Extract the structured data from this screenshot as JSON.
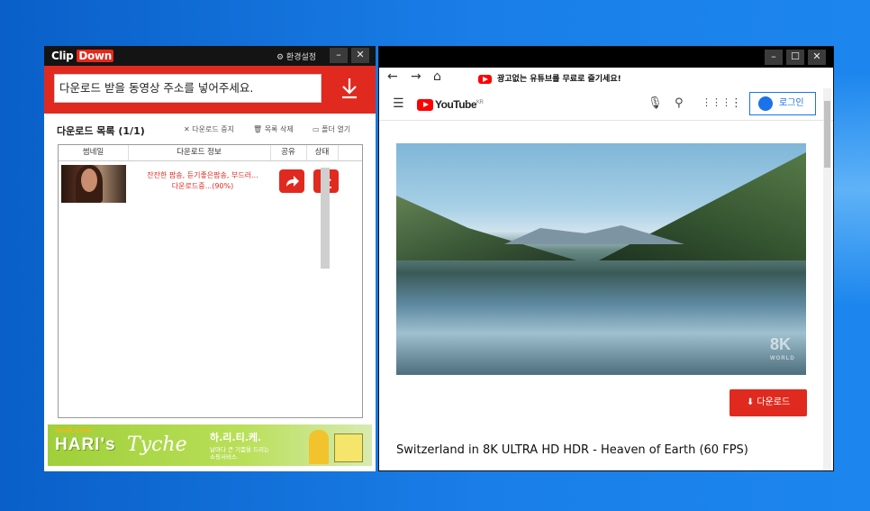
{
  "clipdown": {
    "logo": {
      "clip": "Clip",
      "down": "Down"
    },
    "settings_label": "⚙ 환경설정",
    "window_buttons": {
      "min": "–",
      "close": "✕"
    },
    "url_placeholder": "다운로드 받을 동영상 주소를 넣어주세요.",
    "list_title": "다운로드 목록 (1/1)",
    "actions": {
      "stop": "✕ 다운로드 중지",
      "delete": "🗑 목록 삭제",
      "folder": "▭ 폴더 열기"
    },
    "columns": [
      "썸네일",
      "다운로드 정보",
      "공유",
      "상태"
    ],
    "row": {
      "info_line1": "잔잔한 팝송, 듣기좋은팝송, 부드러...",
      "info_line2": "다운로드중...(90%)",
      "progress_percent": 90
    },
    "banner": {
      "mall": "mall.com",
      "haris": "HARI's",
      "tyche": "Tyche",
      "tagline": "하.리.티.케.",
      "sub1": "날마다 큰 기쁨을 드리는",
      "sub2": "쇼핑서비스."
    }
  },
  "browser": {
    "window_buttons": {
      "min": "–",
      "max": "☐",
      "close": "✕"
    },
    "nav": {
      "back": "←",
      "forward": "→",
      "home": "⌂"
    },
    "promo_text": "광고없는 유튜브를 무료로 즐기세요!",
    "youtube": {
      "logo": "YouTube",
      "region": "KR",
      "login": "로그인"
    },
    "badge": {
      "big": "8K",
      "small": "WORLD"
    },
    "download_button": "다운로드",
    "video_title": "Switzerland in 8K ULTRA HD HDR - Heaven of Earth (60 FPS)"
  },
  "colors": {
    "accent_red": "#e02a1f",
    "desktop_blue": "#1a7ee8",
    "youtube_blue": "#1a73e8"
  }
}
